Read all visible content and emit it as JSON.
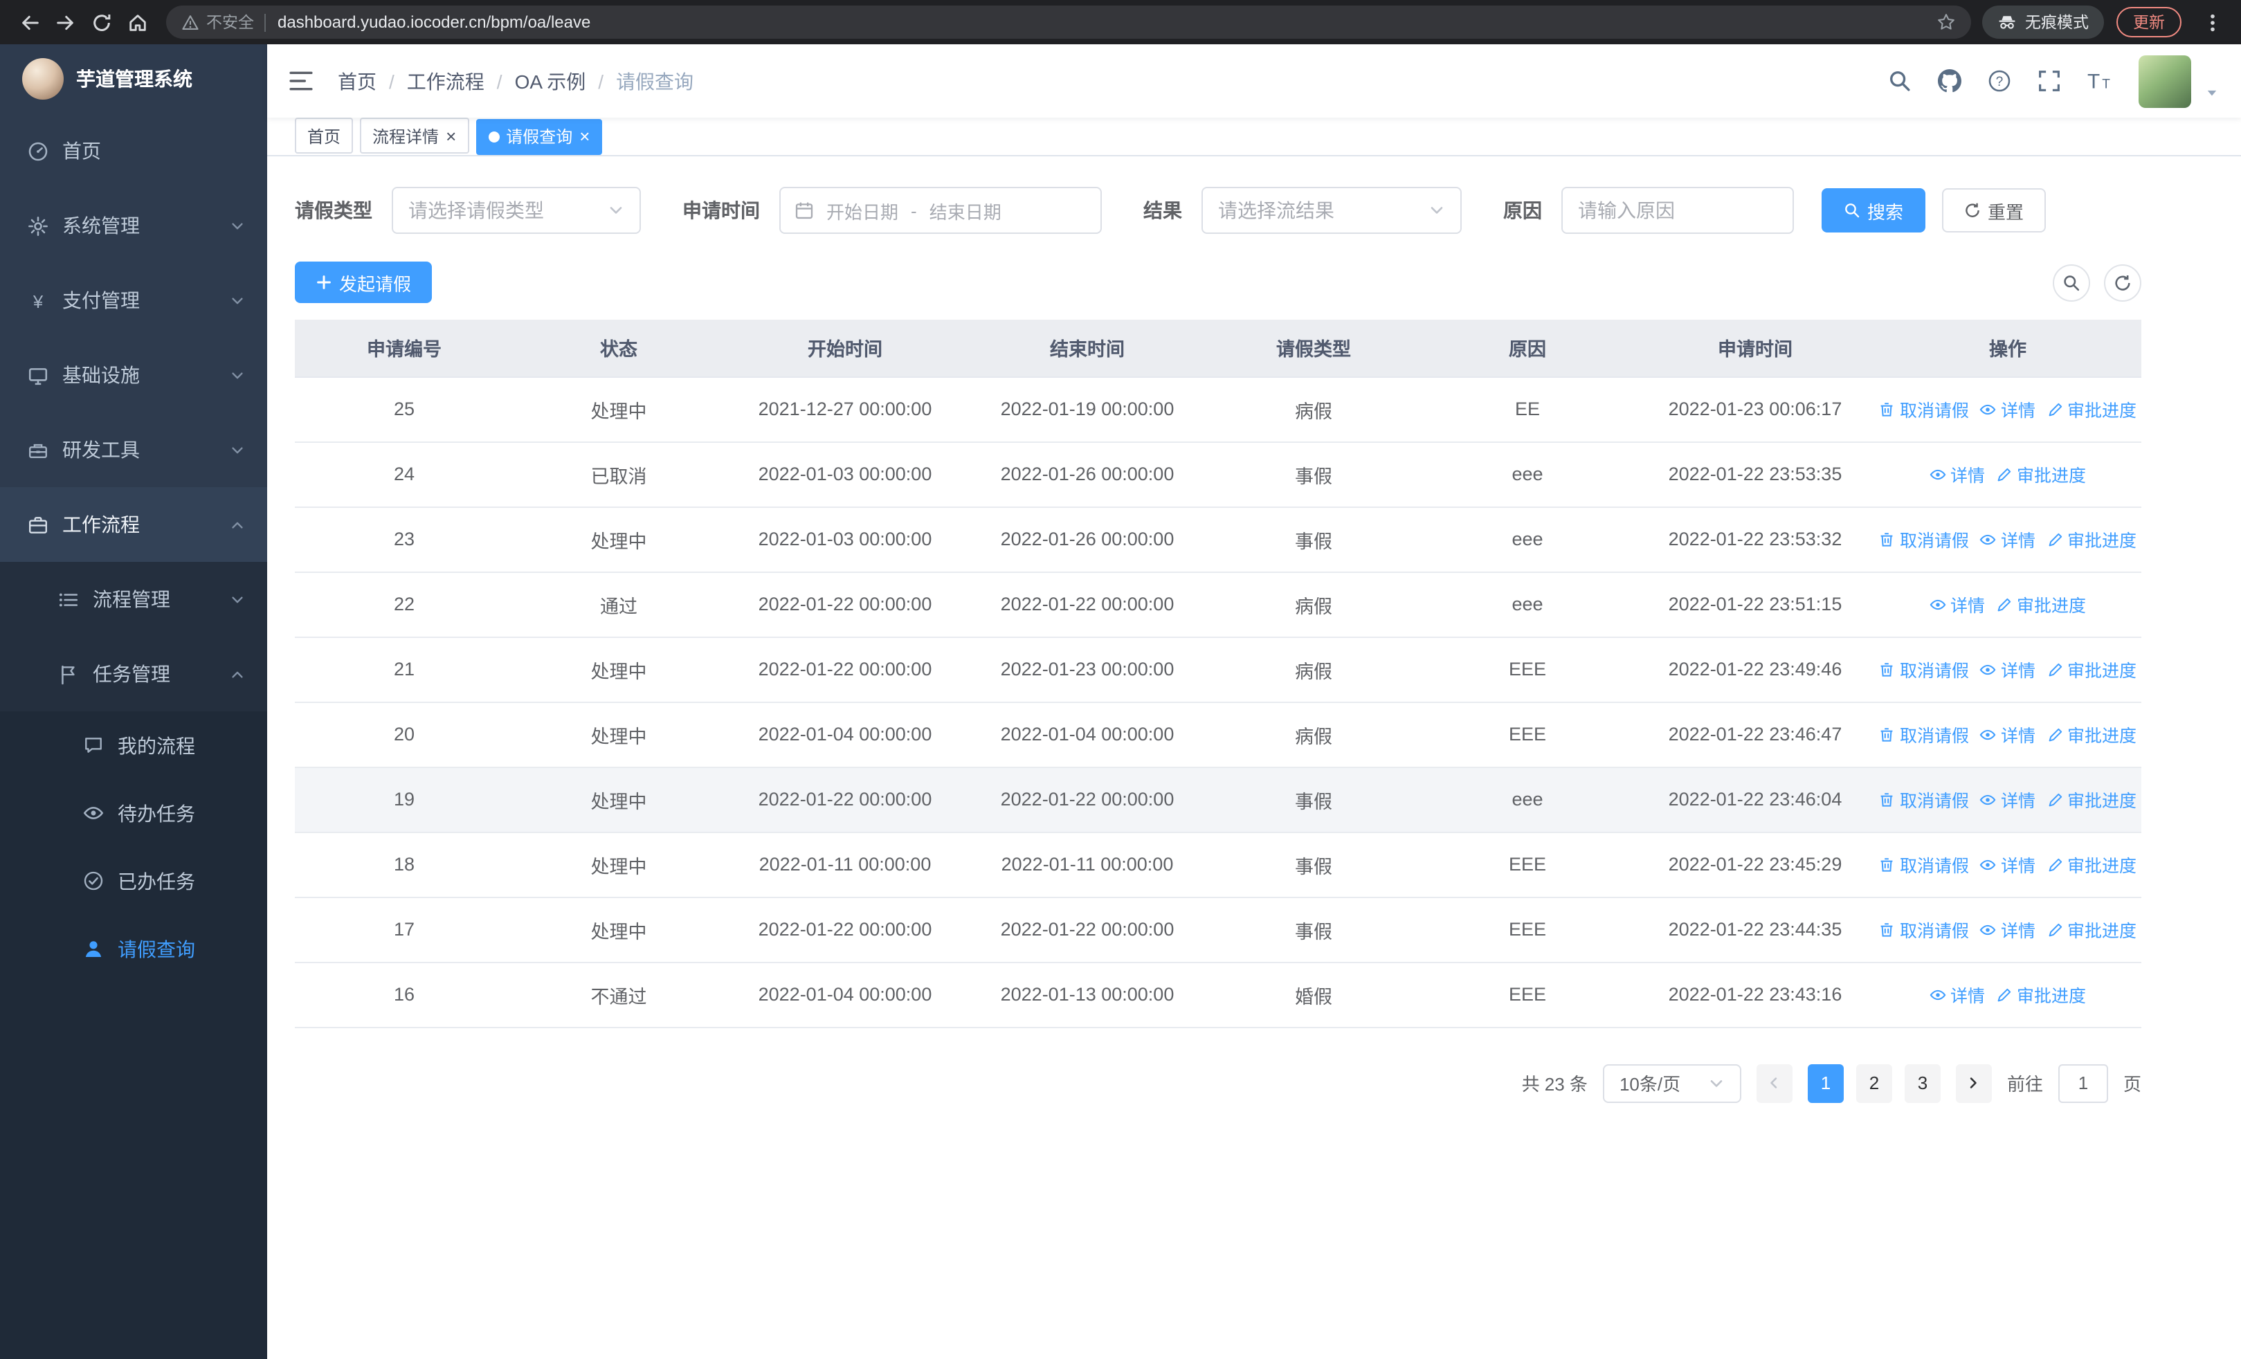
{
  "colors": {
    "primary": "#409eff",
    "sidebar_base": "#2e3b4e",
    "sidebar_sub": "#242f3e",
    "sidebar_deep": "#1f2a38"
  },
  "browser": {
    "nav_icons": [
      "back",
      "forward",
      "reload",
      "home"
    ],
    "security_label": "不安全",
    "url": "dashboard.yudao.iocoder.cn/bpm/oa/leave",
    "incognito_label": "无痕模式",
    "update_label": "更新"
  },
  "sidebar": {
    "title": "芋道管理系统",
    "menu": [
      {
        "name": "home",
        "label": "首页",
        "icon": "dashboard",
        "level": 1
      },
      {
        "name": "system-management",
        "label": "系统管理",
        "icon": "gear",
        "level": 1,
        "arrow": "down"
      },
      {
        "name": "payment-management",
        "label": "支付管理",
        "icon": "yen",
        "level": 1,
        "arrow": "down"
      },
      {
        "name": "infrastructure",
        "label": "基础设施",
        "icon": "monitor",
        "level": 1,
        "arrow": "down"
      },
      {
        "name": "dev-tools",
        "label": "研发工具",
        "icon": "toolbox",
        "level": 1,
        "arrow": "down"
      },
      {
        "name": "workflow",
        "label": "工作流程",
        "icon": "briefcase",
        "level": 1,
        "arrow": "up",
        "open": true
      },
      {
        "name": "process-management",
        "label": "流程管理",
        "icon": "list",
        "level": 2,
        "arrow": "down"
      },
      {
        "name": "task-management",
        "label": "任务管理",
        "icon": "flag",
        "level": 2,
        "arrow": "up",
        "open": true
      },
      {
        "name": "my-processes",
        "label": "我的流程",
        "icon": "chat",
        "level": 3
      },
      {
        "name": "todo-tasks",
        "label": "待办任务",
        "icon": "eye",
        "level": 3
      },
      {
        "name": "done-tasks",
        "label": "已办任务",
        "icon": "check",
        "level": 3
      },
      {
        "name": "leave-query",
        "label": "请假查询",
        "icon": "user",
        "level": 3,
        "active": true
      }
    ]
  },
  "header": {
    "breadcrumb": [
      "首页",
      "工作流程",
      "OA 示例",
      "请假查询"
    ],
    "tool_icons": [
      "search",
      "github",
      "question",
      "fullscreen",
      "font-size"
    ]
  },
  "tabs": [
    {
      "name": "home",
      "label": "首页"
    },
    {
      "name": "process-detail",
      "label": "流程详情",
      "closable": true
    },
    {
      "name": "leave-query",
      "label": "请假查询",
      "closable": true,
      "active": true
    }
  ],
  "filters": {
    "leave_type_label": "请假类型",
    "leave_type_placeholder": "请选择请假类型",
    "apply_time_label": "申请时间",
    "date_start_placeholder": "开始日期",
    "date_separator": "-",
    "date_end_placeholder": "结束日期",
    "result_label": "结果",
    "result_placeholder": "请选择流结果",
    "reason_label": "原因",
    "reason_placeholder": "请输入原因",
    "search_button": "搜索",
    "reset_button": "重置"
  },
  "toolbar": {
    "create_button": "发起请假"
  },
  "table": {
    "columns": [
      "申请编号",
      "状态",
      "开始时间",
      "结束时间",
      "请假类型",
      "原因",
      "申请时间",
      "操作"
    ],
    "action_labels": {
      "cancel": "取消请假",
      "detail": "详情",
      "progress": "审批进度"
    },
    "rows": [
      {
        "id": "25",
        "status": "处理中",
        "start_time": "2021-12-27 00:00:00",
        "end_time": "2022-01-19 00:00:00",
        "leave_type": "病假",
        "reason": "EE",
        "apply_time": "2022-01-23 00:06:17",
        "actions": [
          "cancel",
          "detail",
          "progress"
        ]
      },
      {
        "id": "24",
        "status": "已取消",
        "start_time": "2022-01-03 00:00:00",
        "end_time": "2022-01-26 00:00:00",
        "leave_type": "事假",
        "reason": "eee",
        "apply_time": "2022-01-22 23:53:35",
        "actions": [
          "detail",
          "progress"
        ]
      },
      {
        "id": "23",
        "status": "处理中",
        "start_time": "2022-01-03 00:00:00",
        "end_time": "2022-01-26 00:00:00",
        "leave_type": "事假",
        "reason": "eee",
        "apply_time": "2022-01-22 23:53:32",
        "actions": [
          "cancel",
          "detail",
          "progress"
        ]
      },
      {
        "id": "22",
        "status": "通过",
        "start_time": "2022-01-22 00:00:00",
        "end_time": "2022-01-22 00:00:00",
        "leave_type": "病假",
        "reason": "eee",
        "apply_time": "2022-01-22 23:51:15",
        "actions": [
          "detail",
          "progress"
        ]
      },
      {
        "id": "21",
        "status": "处理中",
        "start_time": "2022-01-22 00:00:00",
        "end_time": "2022-01-23 00:00:00",
        "leave_type": "病假",
        "reason": "EEE",
        "apply_time": "2022-01-22 23:49:46",
        "actions": [
          "cancel",
          "detail",
          "progress"
        ]
      },
      {
        "id": "20",
        "status": "处理中",
        "start_time": "2022-01-04 00:00:00",
        "end_time": "2022-01-04 00:00:00",
        "leave_type": "病假",
        "reason": "EEE",
        "apply_time": "2022-01-22 23:46:47",
        "actions": [
          "cancel",
          "detail",
          "progress"
        ]
      },
      {
        "id": "19",
        "status": "处理中",
        "start_time": "2022-01-22 00:00:00",
        "end_time": "2022-01-22 00:00:00",
        "leave_type": "事假",
        "reason": "eee",
        "apply_time": "2022-01-22 23:46:04",
        "actions": [
          "cancel",
          "detail",
          "progress"
        ],
        "highlighted": true
      },
      {
        "id": "18",
        "status": "处理中",
        "start_time": "2022-01-11 00:00:00",
        "end_time": "2022-01-11 00:00:00",
        "leave_type": "事假",
        "reason": "EEE",
        "apply_time": "2022-01-22 23:45:29",
        "actions": [
          "cancel",
          "detail",
          "progress"
        ]
      },
      {
        "id": "17",
        "status": "处理中",
        "start_time": "2022-01-22 00:00:00",
        "end_time": "2022-01-22 00:00:00",
        "leave_type": "事假",
        "reason": "EEE",
        "apply_time": "2022-01-22 23:44:35",
        "actions": [
          "cancel",
          "detail",
          "progress"
        ]
      },
      {
        "id": "16",
        "status": "不通过",
        "start_time": "2022-01-04 00:00:00",
        "end_time": "2022-01-13 00:00:00",
        "leave_type": "婚假",
        "reason": "EEE",
        "apply_time": "2022-01-22 23:43:16",
        "actions": [
          "detail",
          "progress"
        ]
      }
    ]
  },
  "pagination": {
    "total_text": "共 23 条",
    "page_size": "10条/页",
    "pages": [
      "1",
      "2",
      "3"
    ],
    "active_page": "1",
    "goto_label": "前往",
    "goto_value": "1",
    "page_suffix": "页"
  }
}
